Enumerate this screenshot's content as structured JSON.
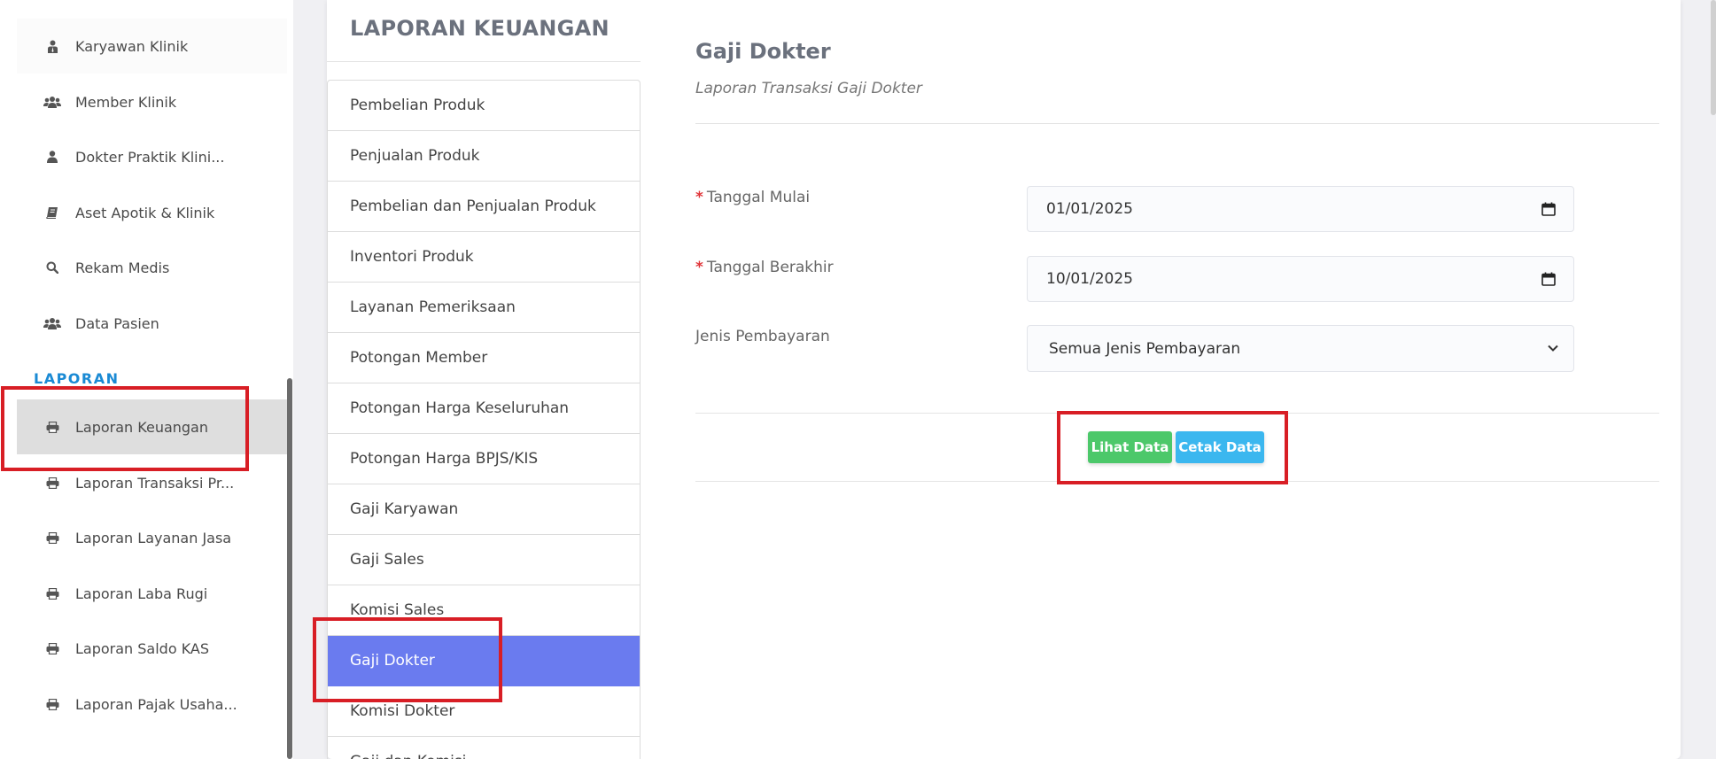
{
  "sidebar": {
    "items": [
      {
        "label": "Karyawan Klinik",
        "icon": "person-tie-icon"
      },
      {
        "label": "Member Klinik",
        "icon": "users-icon"
      },
      {
        "label": "Dokter Praktik Klini...",
        "icon": "user-icon"
      },
      {
        "label": "Aset Apotik & Klinik",
        "icon": "book-icon"
      },
      {
        "label": "Rekam Medis",
        "icon": "search-icon"
      },
      {
        "label": "Data Pasien",
        "icon": "users-icon"
      }
    ],
    "section_label": "LAPORAN",
    "report_items": [
      {
        "label": "Laporan Keuangan",
        "icon": "printer-icon",
        "active": true
      },
      {
        "label": "Laporan Transaksi Pr...",
        "icon": "printer-icon"
      },
      {
        "label": "Laporan Layanan Jasa",
        "icon": "printer-icon"
      },
      {
        "label": "Laporan Laba Rugi",
        "icon": "printer-icon"
      },
      {
        "label": "Laporan Saldo KAS",
        "icon": "printer-icon"
      },
      {
        "label": "Laporan Pajak Usaha...",
        "icon": "printer-icon"
      }
    ]
  },
  "menu": {
    "title": "LAPORAN KEUANGAN",
    "items": [
      {
        "label": "Pembelian Produk"
      },
      {
        "label": "Penjualan Produk"
      },
      {
        "label": "Pembelian dan Penjualan Produk"
      },
      {
        "label": "Inventori Produk"
      },
      {
        "label": "Layanan Pemeriksaan"
      },
      {
        "label": "Potongan Member"
      },
      {
        "label": "Potongan Harga Keseluruhan"
      },
      {
        "label": "Potongan Harga BPJS/KIS"
      },
      {
        "label": "Gaji Karyawan"
      },
      {
        "label": "Gaji Sales"
      },
      {
        "label": "Komisi Sales"
      },
      {
        "label": "Gaji Dokter",
        "active": true
      },
      {
        "label": "Komisi Dokter"
      },
      {
        "label": "Gaji dan Komisi"
      }
    ]
  },
  "form": {
    "title": "Gaji Dokter",
    "subtitle": "Laporan Transaksi Gaji Dokter",
    "required_mark": "*",
    "start_label": "Tanggal Mulai",
    "start_value": "01/01/2025",
    "end_label": "Tanggal Berakhir",
    "end_value": "10/01/2025",
    "payment_label": "Jenis Pembayaran",
    "payment_value": "Semua Jenis Pembayaran",
    "view_button": "Lihat Data",
    "print_button": "Cetak Data"
  },
  "colors": {
    "accent": "#6a7bef",
    "section": "#1a8ad4",
    "view_button": "#4cc86a",
    "print_button": "#3bb7ef",
    "highlight": "#d81e25"
  }
}
